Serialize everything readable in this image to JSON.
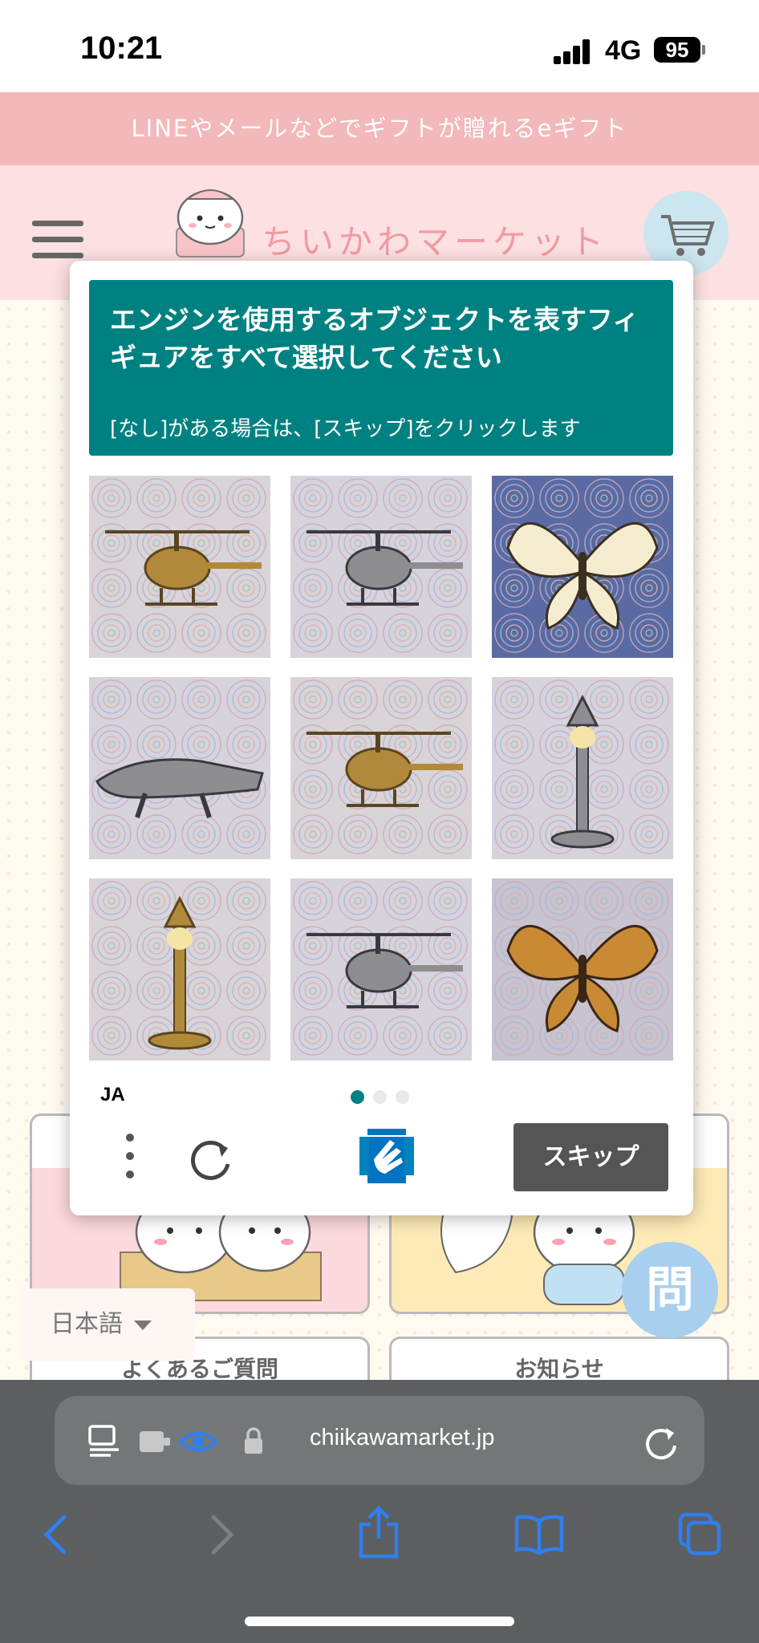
{
  "status_bar": {
    "time": "10:21",
    "network": "4G",
    "battery": "95"
  },
  "banner": {
    "text": "LINEやメールなどでギフトが贈れるeギフト"
  },
  "header": {
    "logo_text": "ちいかわマーケット"
  },
  "captcha": {
    "title": "エンジンを使用するオブジェクトを表すフィギュアをすべて選択してください",
    "subtitle": "[なし]がある場合は、[スキップ]をクリックします",
    "language": "JA",
    "skip_label": "スキップ",
    "tiles": [
      {
        "subject": "helicopter",
        "tone": "gold"
      },
      {
        "subject": "helicopter",
        "tone": "silver"
      },
      {
        "subject": "butterfly",
        "tone": "cream"
      },
      {
        "subject": "crocodile",
        "tone": "silver"
      },
      {
        "subject": "helicopter",
        "tone": "gold"
      },
      {
        "subject": "street-lamp",
        "tone": "silver"
      },
      {
        "subject": "street-lamp",
        "tone": "gold"
      },
      {
        "subject": "helicopter",
        "tone": "silver"
      },
      {
        "subject": "butterfly",
        "tone": "amber"
      }
    ],
    "pages": 3,
    "current_page": 1
  },
  "cards": {
    "faq_label": "よくあるご質問",
    "news_label": "お知らせ"
  },
  "language_selector": {
    "label": "日本語"
  },
  "chat_button": {
    "label": "問"
  },
  "browser": {
    "url": "chiikawamarket.jp"
  },
  "colors": {
    "captcha_teal": "#008181",
    "banner_pink": "#f2b8ba",
    "header_pink": "#fde0e2",
    "skip_gray": "#555555",
    "ios_blue": "#2f7ff0"
  }
}
